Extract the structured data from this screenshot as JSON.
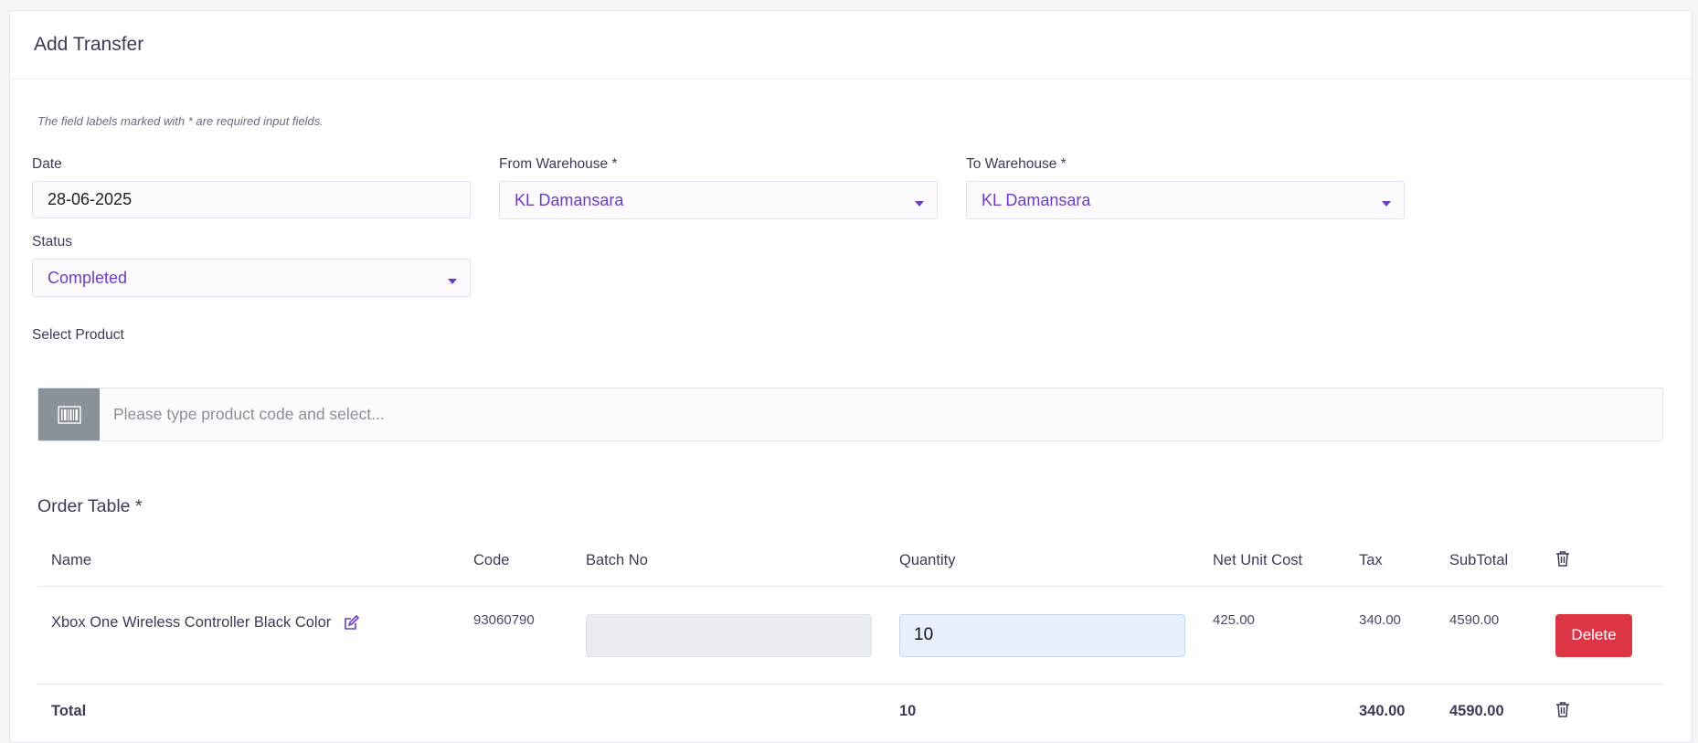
{
  "page": {
    "title": "Add Transfer",
    "hint": "The field labels marked with * are required input fields."
  },
  "form": {
    "date_label": "Date",
    "date_value": "28-06-2025",
    "from_label": "From Warehouse *",
    "from_value": "KL Damansara",
    "to_label": "To Warehouse *",
    "to_value": "KL Damansara",
    "status_label": "Status",
    "status_value": "Completed",
    "product_label": "Select Product",
    "product_placeholder": "Please type product code and select..."
  },
  "order_table": {
    "title": "Order Table *",
    "columns": [
      "Name",
      "Code",
      "Batch No",
      "Quantity",
      "Net Unit Cost",
      "Tax",
      "SubTotal"
    ],
    "rows": [
      {
        "name": "Xbox One Wireless Controller Black Color",
        "code": "93060790",
        "batch_no": "",
        "quantity": "10",
        "net_unit_cost": "425.00",
        "tax": "340.00",
        "subtotal": "4590.00",
        "action_label": "Delete"
      }
    ],
    "total": {
      "label": "Total",
      "quantity": "10",
      "tax": "340.00",
      "subtotal": "4590.00"
    }
  },
  "colors": {
    "accent": "#6d3cc4",
    "danger": "#dc3545",
    "addon": "#8a9299"
  },
  "icons": {
    "barcode": "barcode-icon",
    "edit": "edit-icon",
    "trash": "trash-icon",
    "caret": "caret-down-icon"
  }
}
